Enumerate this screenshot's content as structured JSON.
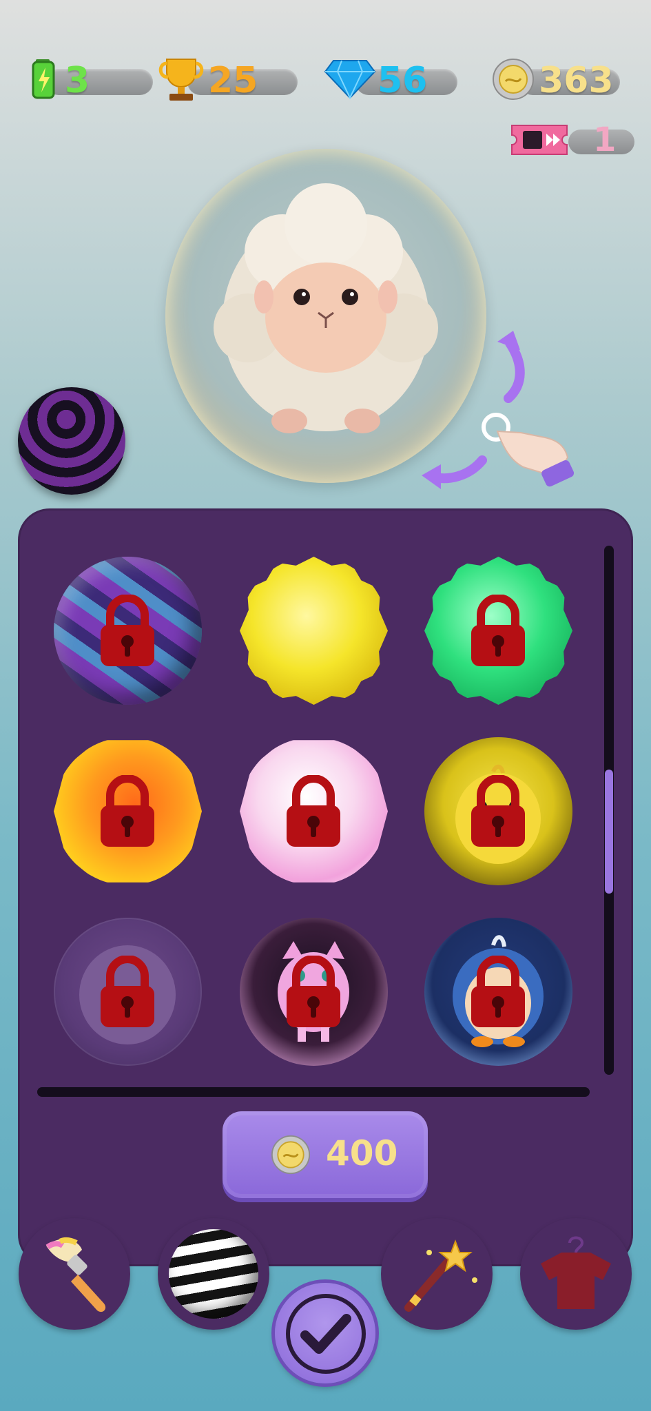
{
  "hud": {
    "energy": {
      "value": "3",
      "icon": "battery-icon",
      "color": "#6ee24a"
    },
    "trophies": {
      "value": "25",
      "icon": "trophy-icon",
      "color": "#f5a623"
    },
    "gems": {
      "value": "56",
      "icon": "diamond-icon",
      "color": "#1ec0f0"
    },
    "coins": {
      "value": "363",
      "icon": "coin-icon",
      "color": "#f7e08b"
    },
    "tickets": {
      "value": "1",
      "icon": "ticket-icon",
      "color": "#f2a7c3"
    }
  },
  "preview": {
    "character": "sheep",
    "skin_icon": "striped-ball-icon"
  },
  "grid": {
    "items": [
      {
        "name": "striped-ball",
        "locked": true
      },
      {
        "name": "yellow-crystal",
        "locked": false
      },
      {
        "name": "green-crystal",
        "locked": true
      },
      {
        "name": "orange-gem",
        "locked": true
      },
      {
        "name": "pink-gem",
        "locked": true
      },
      {
        "name": "chick-bubble",
        "locked": true
      },
      {
        "name": "sheep-bubble",
        "locked": true
      },
      {
        "name": "cat-bubble",
        "locked": true
      },
      {
        "name": "penguin-bubble",
        "locked": true
      }
    ]
  },
  "purchase": {
    "price": "400",
    "currency_icon": "coin-icon"
  },
  "tabs": [
    {
      "name": "paint-brush-icon"
    },
    {
      "name": "ball-skin-icon"
    },
    {
      "name": "magic-wand-icon"
    },
    {
      "name": "shirt-icon"
    }
  ],
  "confirm": {
    "icon": "checkmark-icon"
  }
}
